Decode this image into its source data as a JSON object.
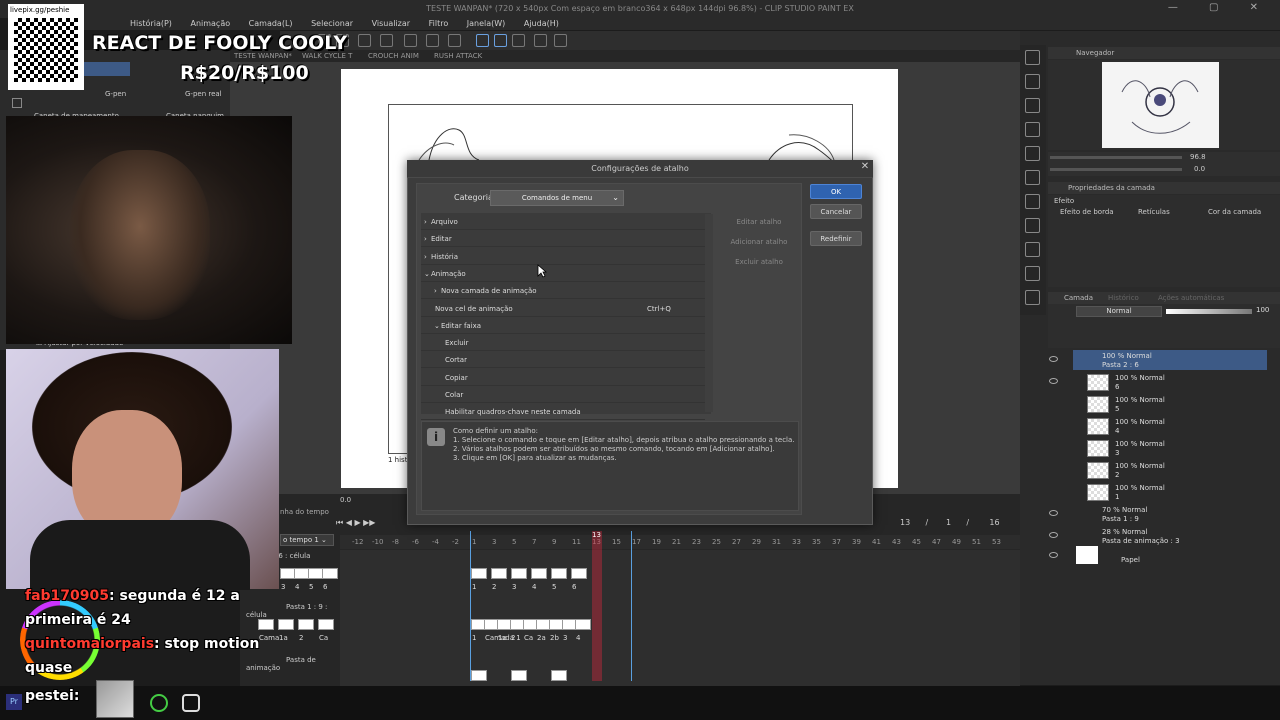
{
  "app": {
    "title": "TESTE WANPAN* (720 x 540px Com espaço em branco364 x 648px 144dpi 96.8%) - CLIP STUDIO PAINT EX",
    "menu": [
      "História(P)",
      "Animação",
      "Camada(L)",
      "Selecionar",
      "Visualizar",
      "Filtro",
      "Janela(W)",
      "Ajuda(H)"
    ],
    "window_controls": "— ▢ ✕"
  },
  "canvas_tabs": [
    "TESTE WANPAN*",
    "WALK CYCLE T",
    "CROUCH ANIM",
    "RUSH ATTACK"
  ],
  "canvas_caption": "1 hist",
  "brushes": {
    "items": [
      "G-pen",
      "G-pen real",
      "Caneta de mapeamento",
      "Caneta nanquim"
    ]
  },
  "left_option": "Ajustar por velocidade",
  "navigator": {
    "tab": "Navegador",
    "zoom": "96.8",
    "rotation": "0.0"
  },
  "layer_properties": {
    "tab": "Propriedades da camada",
    "effect_label": "Efeito",
    "options": [
      "Efeito de borda",
      "Retículas",
      "Cor da camada"
    ]
  },
  "layers_panel": {
    "tabs": [
      "Camada",
      "Histórico",
      "Ações automáticas"
    ],
    "blend_mode": "Normal",
    "opacity": "100",
    "layers": [
      {
        "line1": "100 % Normal",
        "line2": "Pasta 2 : 6",
        "type": "folder"
      },
      {
        "line1": "100 % Normal",
        "line2": "6",
        "type": "cel"
      },
      {
        "line1": "100 % Normal",
        "line2": "5",
        "type": "cel"
      },
      {
        "line1": "100 % Normal",
        "line2": "4",
        "type": "cel"
      },
      {
        "line1": "100 % Normal",
        "line2": "3",
        "type": "cel"
      },
      {
        "line1": "100 % Normal",
        "line2": "2",
        "type": "cel"
      },
      {
        "line1": "100 % Normal",
        "line2": "1",
        "type": "cel"
      },
      {
        "line1": "70 % Normal",
        "line2": "Pasta 1 : 9",
        "type": "folder"
      },
      {
        "line1": "28 % Normal",
        "line2": "Pasta de animação : 3",
        "type": "folder"
      },
      {
        "line1": "Papel",
        "line2": "",
        "type": "paper"
      }
    ]
  },
  "timeline": {
    "header_value": "0.0",
    "tab": "nha do tempo",
    "track_name": "o tempo 1",
    "current_frame": "13",
    "position": [
      "13",
      "/",
      "1",
      "/",
      "16"
    ],
    "ruler": [
      "-12",
      "-10",
      "-8",
      "-6",
      "-4",
      "-2",
      "1",
      "3",
      "5",
      "7",
      "9",
      "11",
      "13",
      "15",
      "17",
      "19",
      "21",
      "23",
      "25",
      "27",
      "29",
      "31",
      "33",
      "35",
      "37",
      "39",
      "41",
      "43",
      "45",
      "47",
      "49",
      "51",
      "53"
    ],
    "ruler_marks": [
      "0",
      "2",
      "3",
      "4"
    ],
    "rows": [
      "Pasta 2 : 6 : célula",
      "Pasta 1 : 9 : célula",
      "Pasta de animação"
    ],
    "row1_cels": [
      "1",
      "2",
      "3",
      "4",
      "5",
      "6"
    ],
    "row2_cels": [
      "1",
      "Camada 1",
      "1a",
      "2",
      "Ca",
      "2a",
      "2b",
      "3",
      "4"
    ],
    "left_row1": [
      "3",
      "4",
      "5",
      "6"
    ],
    "left_row2": [
      "Cama",
      "1a",
      "2",
      "Ca"
    ]
  },
  "dialog": {
    "title": "Configurações de atalho",
    "category_label": "Categoria:",
    "category_value": "Comandos de menu",
    "commands": [
      {
        "label": "Arquivo",
        "shortcut": "",
        "indent": 0,
        "prefix": "›"
      },
      {
        "label": "Editar",
        "shortcut": "",
        "indent": 0,
        "prefix": "›"
      },
      {
        "label": "História",
        "shortcut": "",
        "indent": 0,
        "prefix": "›"
      },
      {
        "label": "Animação",
        "shortcut": "",
        "indent": 0,
        "prefix": "⌄"
      },
      {
        "label": "Nova camada de animação",
        "shortcut": "",
        "indent": 1,
        "prefix": "›"
      },
      {
        "label": "Nova cel de animação",
        "shortcut": "Ctrl+Q",
        "indent": 1,
        "prefix": ""
      },
      {
        "label": "Editar faixa",
        "shortcut": "",
        "indent": 1,
        "prefix": "⌄"
      },
      {
        "label": "Excluir",
        "shortcut": "",
        "indent": 2,
        "prefix": ""
      },
      {
        "label": "Cortar",
        "shortcut": "",
        "indent": 2,
        "prefix": ""
      },
      {
        "label": "Copiar",
        "shortcut": "",
        "indent": 2,
        "prefix": ""
      },
      {
        "label": "Colar",
        "shortcut": "",
        "indent": 2,
        "prefix": ""
      },
      {
        "label": "Habilitar quadros-chave neste camada",
        "shortcut": "",
        "indent": 2,
        "prefix": ""
      }
    ],
    "side_buttons": [
      "Editar atalho",
      "Adicionar atalho",
      "Excluir atalho"
    ],
    "ok": "OK",
    "cancel": "Cancelar",
    "reset": "Redefinir",
    "help_icon": "i",
    "help_lines": [
      "Como definir um atalho:",
      "1. Selecione o comando e toque em [Editar atalho], depois atribua o atalho pressionando a tecla.",
      "2. Vários atalhos podem ser atribuídos ao mesmo comando, tocando em [Adicionar atalho].",
      "3. Clique em [OK] para atualizar as mudanças."
    ]
  },
  "overlay": {
    "qr_text": "livepix.gg/peshie",
    "react_title": "REACT DE FOOLY COOLY",
    "react_price": "R$20/R$100",
    "chat": [
      {
        "name": "fab170905",
        "text": ": segunda é 12 a"
      },
      {
        "name": "",
        "text": "primeira é 24"
      },
      {
        "name": "quintomaiorpais",
        "text": ": stop motion"
      },
      {
        "name": "",
        "text": "quase"
      },
      {
        "name": "pestei",
        "text": ":"
      }
    ]
  },
  "colors": {
    "accent": "#2f63b0",
    "playhead": "#c8283c",
    "chat_name": "#ff3b30"
  }
}
